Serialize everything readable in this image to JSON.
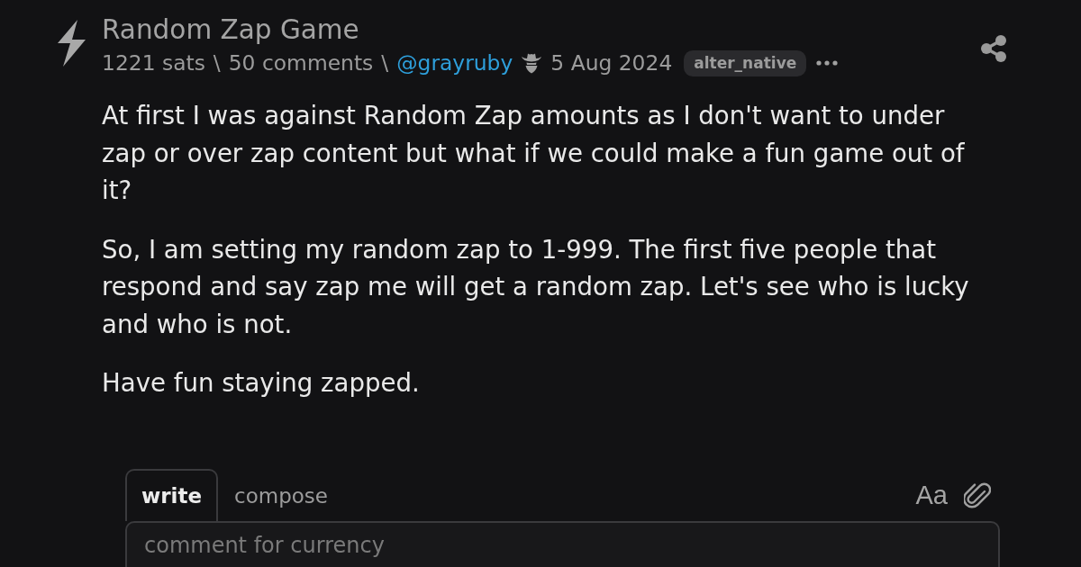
{
  "post": {
    "title": "Random Zap Game",
    "meta": {
      "sats": "1221 sats",
      "comments": "50 comments",
      "separators": [
        "\\",
        "\\"
      ],
      "author": "@grayruby",
      "date": "5 Aug 2024",
      "tag": "alter_native"
    },
    "body": [
      "At first I was against Random Zap amounts as I don't want to under zap or over zap content but what if we could make a fun game out of it?",
      "So, I am setting my random zap to 1-999. The first five people that respond and say zap me will get a random zap. Let's see who is lucky and who is not.",
      "Have fun staying zapped."
    ]
  },
  "editor": {
    "tabs": [
      {
        "label": "write",
        "selected": true
      },
      {
        "label": "compose",
        "selected": false
      }
    ],
    "format_button": "Aa",
    "placeholder": "comment for currency"
  }
}
